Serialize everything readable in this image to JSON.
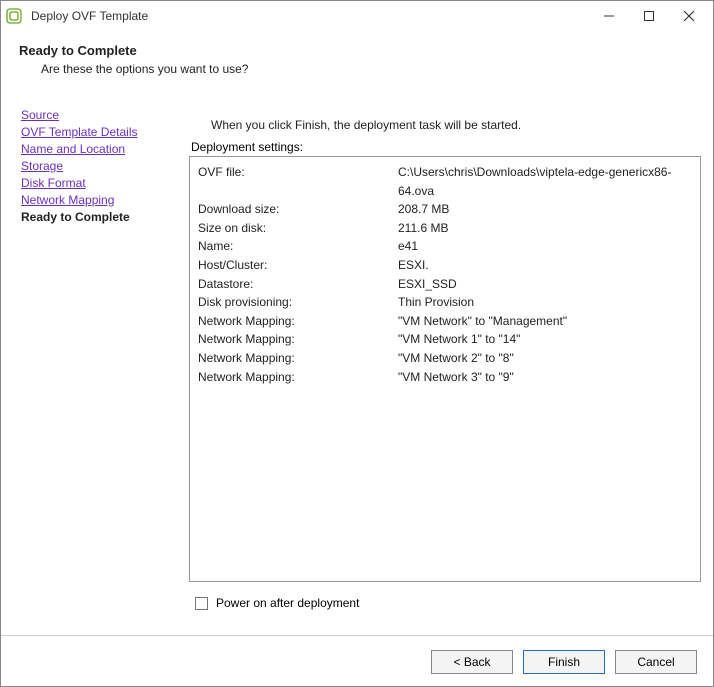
{
  "window": {
    "title": "Deploy OVF Template",
    "heading": "Ready to Complete",
    "subheading": "Are these the options you want to use?"
  },
  "nav": {
    "items": [
      "Source",
      "OVF Template Details",
      "Name and Location",
      "Storage",
      "Disk Format",
      "Network Mapping"
    ],
    "current": "Ready to Complete"
  },
  "content": {
    "intro": "When you click Finish, the deployment task will be started.",
    "groupLabel": "Deployment settings:",
    "rows": [
      {
        "k": "OVF file:",
        "v": "C:\\Users\\chris\\Downloads\\viptela-edge-genericx86-64.ova"
      },
      {
        "k": "Download size:",
        "v": "208.7 MB"
      },
      {
        "k": "Size on disk:",
        "v": "211.6 MB"
      },
      {
        "k": "Name:",
        "v": "e41"
      },
      {
        "k": "Host/Cluster:",
        "v": "ESXI."
      },
      {
        "k": "Datastore:",
        "v": "ESXI_SSD"
      },
      {
        "k": "Disk provisioning:",
        "v": "Thin Provision"
      },
      {
        "k": "Network Mapping:",
        "v": "\"VM Network\" to \"Management\""
      },
      {
        "k": "Network Mapping:",
        "v": "\"VM Network 1\" to \"14\""
      },
      {
        "k": "Network Mapping:",
        "v": "\"VM Network 2\" to \"8\""
      },
      {
        "k": "Network Mapping:",
        "v": "\"VM Network 3\" to \"9\""
      }
    ],
    "powerOnLabel": "Power on after deployment"
  },
  "buttons": {
    "back": "< Back",
    "finish": "Finish",
    "cancel": "Cancel"
  }
}
